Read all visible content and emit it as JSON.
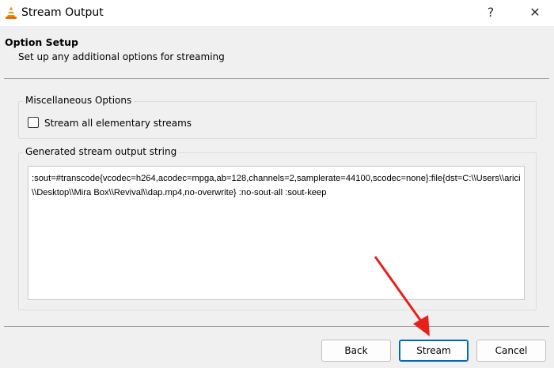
{
  "window": {
    "title": "Stream Output",
    "help_label": "?",
    "close_label": "✕"
  },
  "header": {
    "title": "Option Setup",
    "subtitle": "Set up any additional options for streaming"
  },
  "misc": {
    "legend": "Miscellaneous Options",
    "checkbox_label": "Stream all elementary streams",
    "checked": false
  },
  "output": {
    "legend": "Generated stream output string",
    "value": ":sout=#transcode{vcodec=h264,acodec=mpga,ab=128,channels=2,samplerate=44100,scodec=none}:file{dst=C:\\\\Users\\\\arici\\\\Desktop\\\\Mira Box\\\\Revival\\\\dap.mp4,no-overwrite} :no-sout-all :sout-keep"
  },
  "buttons": {
    "back": "Back",
    "stream": "Stream",
    "cancel": "Cancel"
  },
  "colors": {
    "annotation_arrow": "#e8201c",
    "accent": "#0067c0"
  }
}
